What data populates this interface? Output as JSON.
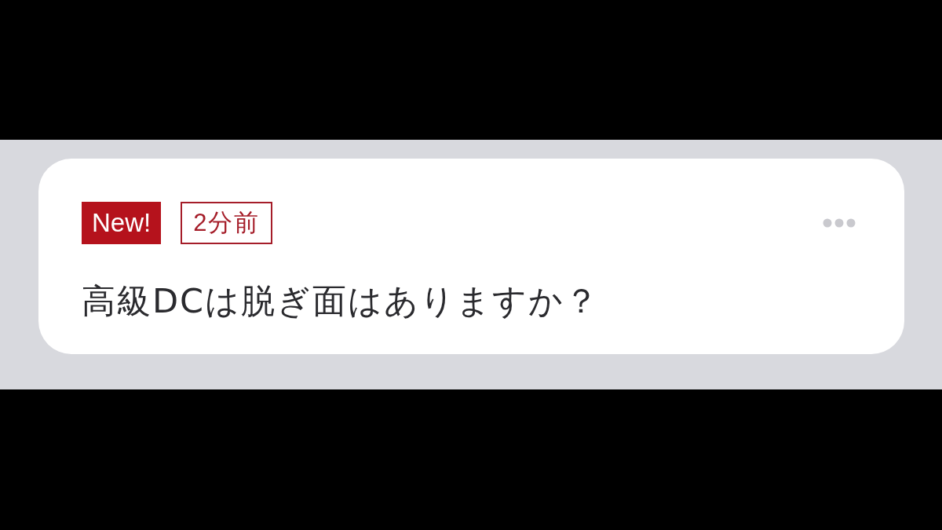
{
  "notification": {
    "badges": [
      {
        "kind": "filled",
        "text": "New!"
      },
      {
        "kind": "outlined",
        "text": "2分前"
      }
    ],
    "question": "高級DCは脱ぎ面はありますか？"
  }
}
